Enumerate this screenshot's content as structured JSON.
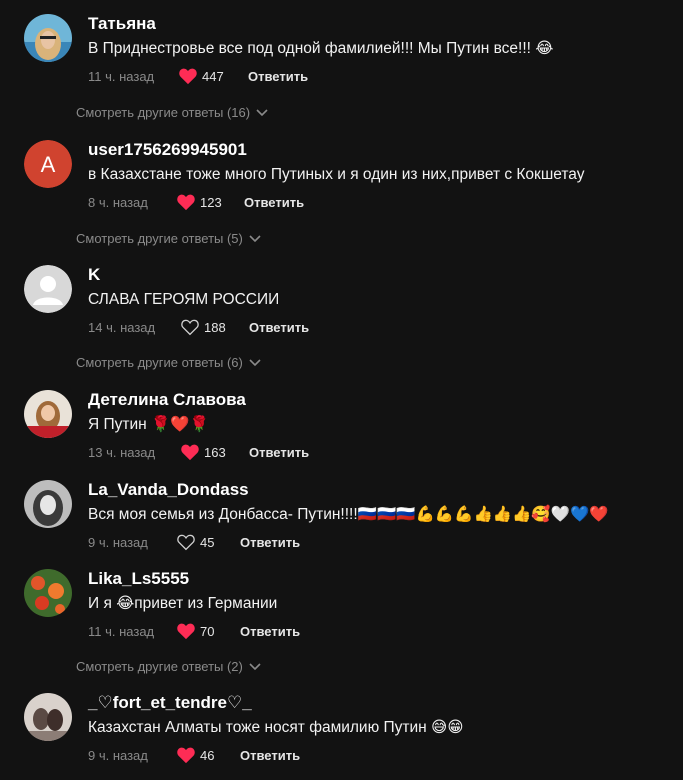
{
  "colors": {
    "background": "#121212",
    "muted": "#8a8a8a",
    "like_active": "#fe2c55",
    "avatar_letter_bg": "#d0432f"
  },
  "comments": [
    {
      "username": "Татьяна",
      "text": "В Приднестровье все под одной фамилией!!! Мы Путин все!!! 😂",
      "time": "11 ч. назад",
      "likes": "447",
      "liked": true,
      "reply_label": "Ответить",
      "avatar": "photo-woman-blue",
      "more_replies": "Смотреть другие ответы (16)"
    },
    {
      "username": "user1756269945901",
      "text": "в Казахстане тоже много Путиных и я один из них,привет с Кокшетау",
      "time": "8 ч. назад",
      "likes": "123",
      "liked": true,
      "reply_label": "Ответить",
      "avatar": "letter",
      "avatar_letter": "A",
      "more_replies": "Смотреть другие ответы (5)"
    },
    {
      "username": "K",
      "text": "СЛАВА ГЕРОЯМ РОССИИ",
      "time": "14 ч. назад",
      "likes": "188",
      "liked": false,
      "reply_label": "Ответить",
      "avatar": "default-person",
      "more_replies": "Смотреть другие ответы (6)"
    },
    {
      "username": "Детелина Славова",
      "text": "Я Путин 🌹❤️🌹",
      "time": "13 ч. назад",
      "likes": "163",
      "liked": true,
      "reply_label": "Ответить",
      "avatar": "photo-woman-red"
    },
    {
      "username": "La_Vanda_Dondass",
      "text": "Вся моя семья из Донбасса- Путин!!!!🇷🇺🇷🇺🇷🇺💪💪💪👍👍👍🥰🤍💙❤️",
      "time": "9 ч. назад",
      "likes": "45",
      "liked": false,
      "reply_label": "Ответить",
      "avatar": "photo-woman-bw"
    },
    {
      "username": "Lika_Ls5555",
      "text": "И я 😂привет из Германии",
      "time": "11 ч. назад",
      "likes": "70",
      "liked": true,
      "reply_label": "Ответить",
      "avatar": "photo-flowers",
      "more_replies": "Смотреть другие ответы (2)"
    },
    {
      "username": "_♡fort_et_tendre♡_",
      "text": "Казахстан Алматы тоже носят фамилию Путин 😅😁",
      "time": "9 ч. назад",
      "likes": "46",
      "liked": true,
      "reply_label": "Ответить",
      "avatar": "photo-couple"
    }
  ]
}
